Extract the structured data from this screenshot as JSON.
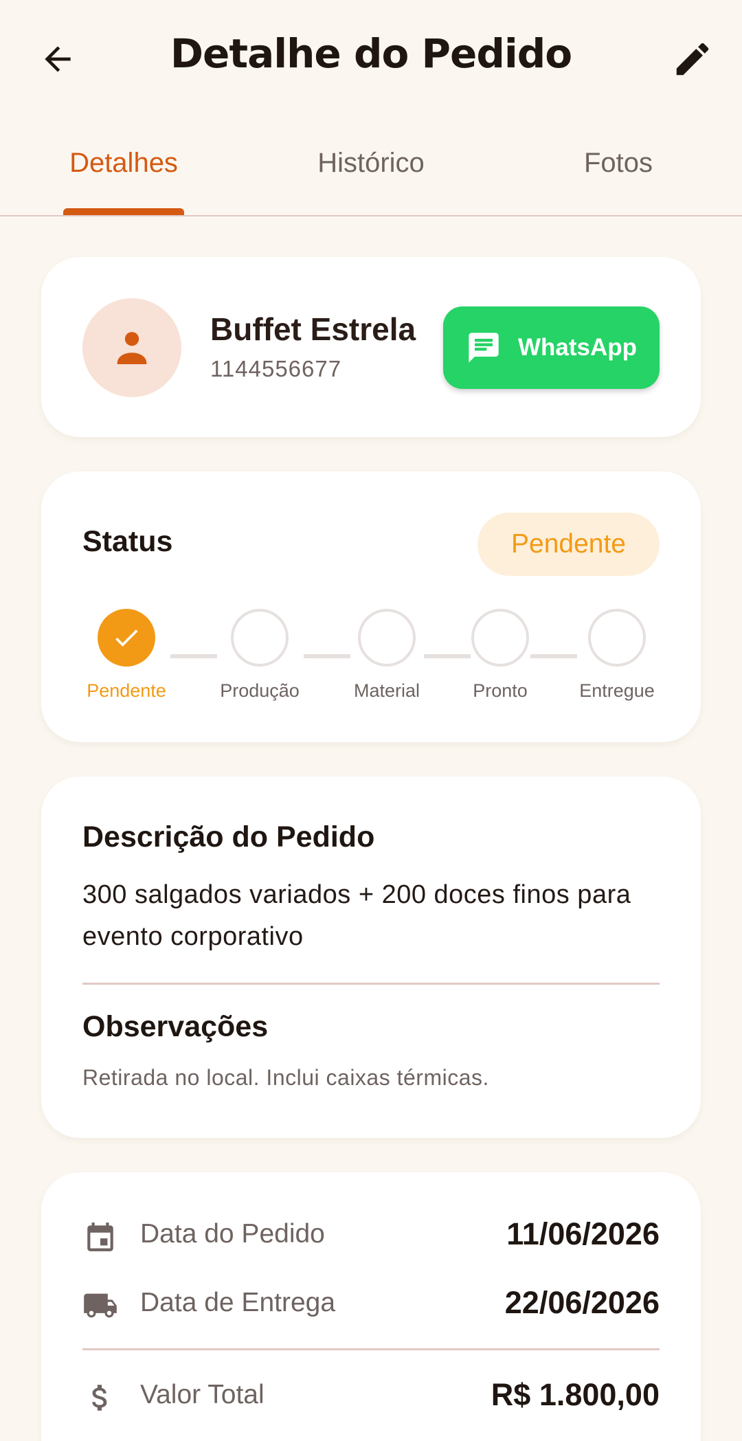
{
  "header": {
    "title": "Detalhe do Pedido"
  },
  "tabs": [
    {
      "label": "Detalhes",
      "active": true
    },
    {
      "label": "Histórico",
      "active": false
    },
    {
      "label": "Fotos",
      "active": false
    }
  ],
  "client": {
    "name": "Buffet Estrela",
    "phone": "1144556677",
    "whatsapp_label": "WhatsApp"
  },
  "status": {
    "title": "Status",
    "current": "Pendente",
    "steps": [
      {
        "label": "Pendente",
        "done": true
      },
      {
        "label": "Produção",
        "done": false
      },
      {
        "label": "Material",
        "done": false
      },
      {
        "label": "Pronto",
        "done": false
      },
      {
        "label": "Entregue",
        "done": false
      }
    ]
  },
  "description": {
    "title": "Descrição do Pedido",
    "text": "300 salgados variados + 200 doces finos para evento corporativo",
    "obs_title": "Observações",
    "obs_text": "Retirada no local. Inclui caixas térmicas."
  },
  "info": {
    "order_date_label": "Data do Pedido",
    "order_date": "11/06/2026",
    "delivery_date_label": "Data de Entrega",
    "delivery_date": "22/06/2026",
    "total_label": "Valor Total",
    "total": "R$ 1.800,00"
  },
  "colors": {
    "accent": "#d45a12",
    "status_pending": "#f29a15",
    "whatsapp": "#25d366",
    "background": "#fbf7f0"
  }
}
